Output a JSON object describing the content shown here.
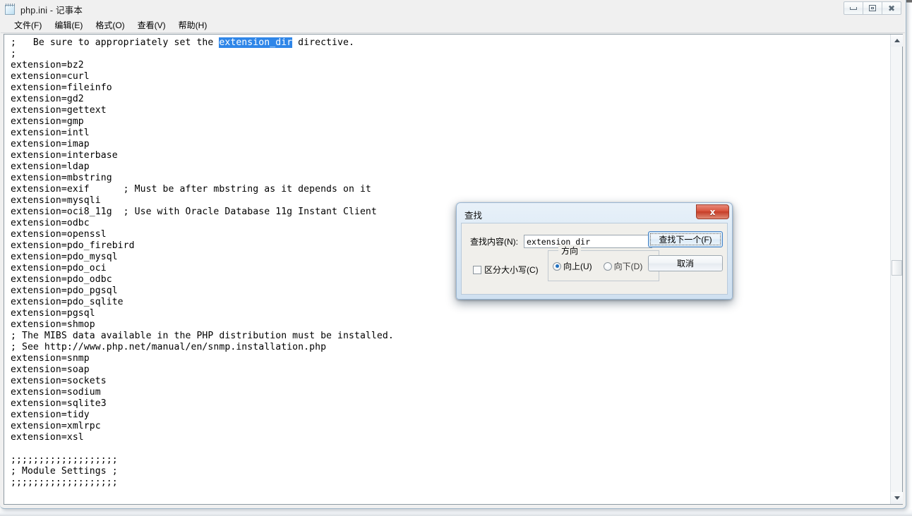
{
  "window": {
    "title": "php.ini - 记事本",
    "icon": "notepad-icon",
    "controls": {
      "minimize": "─",
      "restore": "❐",
      "close": "✕"
    }
  },
  "menubar": {
    "items": [
      {
        "label": "文件(F)"
      },
      {
        "label": "编辑(E)"
      },
      {
        "label": "格式(O)"
      },
      {
        "label": "查看(V)"
      },
      {
        "label": "帮助(H)"
      }
    ]
  },
  "editor": {
    "selection_text": "extension_dir",
    "selection_color": "#2f86e8",
    "line_before_selection": ";   Be sure to appropriately set the ",
    "line_after_selection": " directive.",
    "body": ";\nextension=bz2\nextension=curl\nextension=fileinfo\nextension=gd2\nextension=gettext\nextension=gmp\nextension=intl\nextension=imap\nextension=interbase\nextension=ldap\nextension=mbstring\nextension=exif      ; Must be after mbstring as it depends on it\nextension=mysqli\nextension=oci8_11g  ; Use with Oracle Database 11g Instant Client\nextension=odbc\nextension=openssl\nextension=pdo_firebird\nextension=pdo_mysql\nextension=pdo_oci\nextension=pdo_odbc\nextension=pdo_pgsql\nextension=pdo_sqlite\nextension=pgsql\nextension=shmop\n; The MIBS data available in the PHP distribution must be installed.\n; See http://www.php.net/manual/en/snmp.installation.php\nextension=snmp\nextension=soap\nextension=sockets\nextension=sodium\nextension=sqlite3\nextension=tidy\nextension=xmlrpc\nextension=xsl\n\n;;;;;;;;;;;;;;;;;;;\n; Module Settings ;\n;;;;;;;;;;;;;;;;;;;"
  },
  "scrollbar": {
    "up_arrow": "▲",
    "down_arrow": "▼"
  },
  "find_dialog": {
    "title": "查找",
    "close_label": "x",
    "find_what_label": "查找内容(N):",
    "find_what_value": "extension_dir",
    "match_case_label": "区分大小写(C)",
    "match_case_checked": false,
    "direction_group_label": "方向",
    "direction_options": [
      {
        "label": "向上(U)",
        "checked": true
      },
      {
        "label": "向下(D)",
        "checked": false
      }
    ],
    "find_next_label": "查找下一个(F)",
    "cancel_label": "取消"
  }
}
